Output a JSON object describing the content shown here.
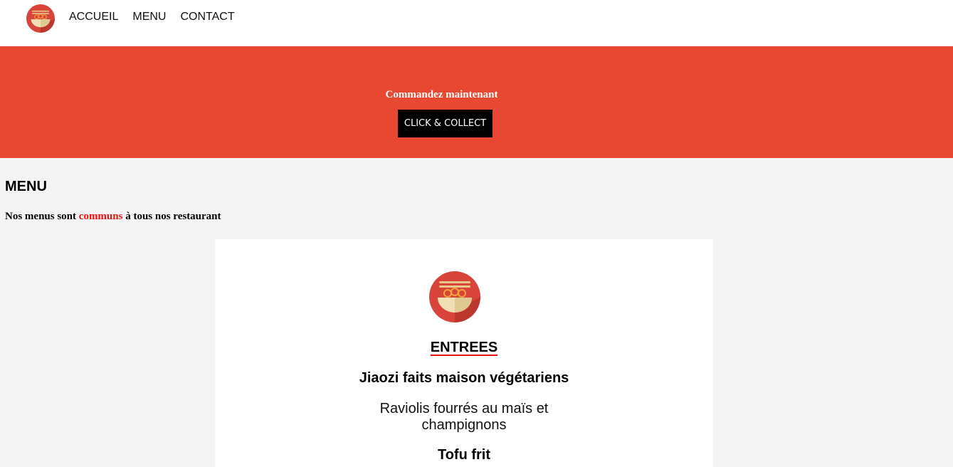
{
  "nav": {
    "items": [
      {
        "label": "ACCUEIL"
      },
      {
        "label": "MENU"
      },
      {
        "label": "CONTACT"
      }
    ]
  },
  "banner": {
    "text": "Commandez maintenant",
    "button_label": "CLICK & COLLECT",
    "background": "#e84731"
  },
  "menu_section": {
    "title": "MENU",
    "subtitle_before": "Nos menus sont ",
    "subtitle_highlight": "communs",
    "subtitle_after": " à tous nos restaurant",
    "highlight_color": "#e8120c"
  },
  "card": {
    "logo_icon": "noodle-bowl-icon",
    "category": "ENTREES",
    "dishes": [
      {
        "name": "Jiaozi faits maison végétariens",
        "description": "Raviolis fourrés au maïs et champignons"
      },
      {
        "name": "Tofu frit",
        "description": ""
      }
    ]
  }
}
